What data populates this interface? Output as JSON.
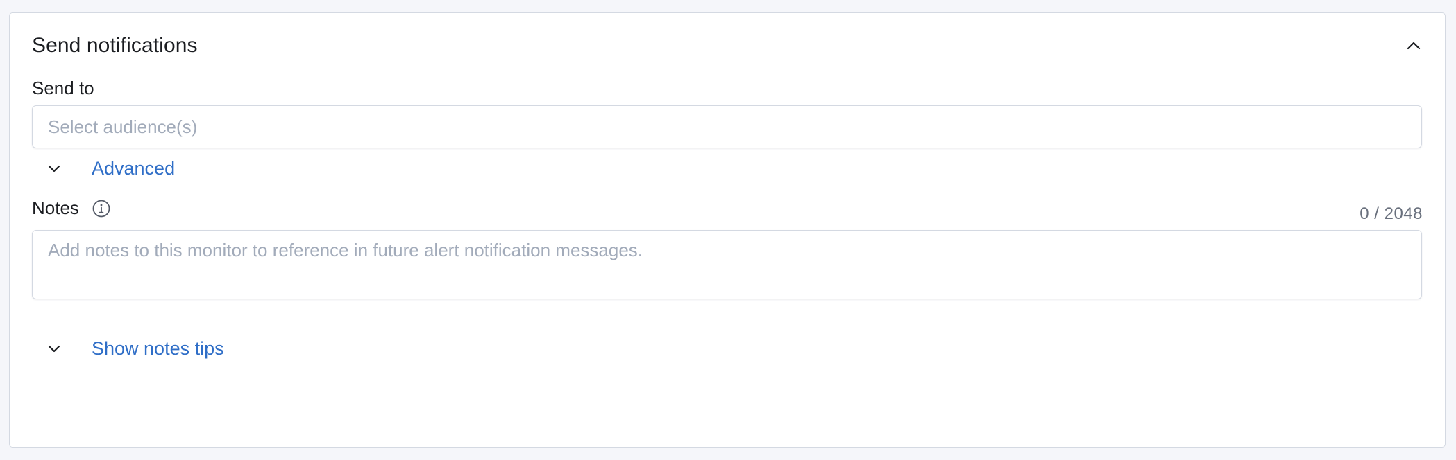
{
  "panel": {
    "title": "Send notifications",
    "collapse_icon": "chevron-up-icon"
  },
  "send_to": {
    "label": "Send to",
    "placeholder": "Select audience(s)",
    "value": ""
  },
  "advanced": {
    "label": "Advanced",
    "icon": "chevron-down-icon"
  },
  "notes": {
    "label": "Notes",
    "info_icon": "info-icon",
    "char_count": "0 / 2048",
    "placeholder": "Add notes to this monitor to reference in future alert notification messages.",
    "value": ""
  },
  "notes_tips": {
    "label": "Show notes tips",
    "icon": "chevron-down-icon"
  },
  "colors": {
    "link": "#2f6ec7",
    "border": "#d4d9e2",
    "placeholder": "#a2abba",
    "background": "#f5f6fa"
  }
}
